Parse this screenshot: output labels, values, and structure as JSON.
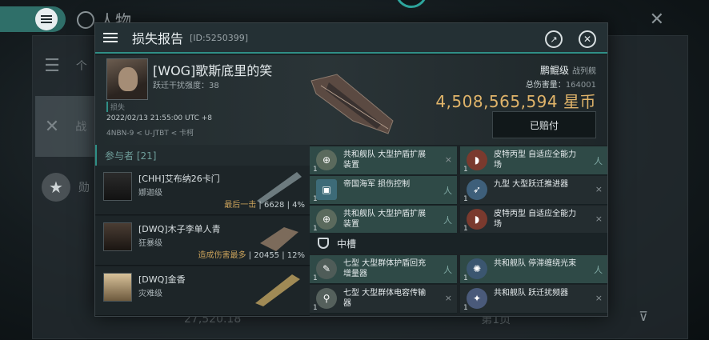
{
  "background": {
    "header_title": "人物",
    "frag_tab1": "个",
    "frag_tab2": "战",
    "frag_tab3": "勋",
    "bottom_value": "27,520.18",
    "bottom_right": "第1页"
  },
  "dialog": {
    "title": "损失报告",
    "report_id": "[ID:5250399]",
    "pilot": {
      "name": "[WOG]歌斯底里的笑",
      "sub": "跃迁干扰强度：38"
    },
    "loss_tag": "损失",
    "time": "2022/02/13 21:55:00 UTC +8",
    "location": "4NBN-9 < U-JTBT < 卡柯",
    "ship": {
      "name": "鹏鲲级",
      "class": "战列舰",
      "damage_label": "总伤害量：",
      "damage_value": "164001",
      "isk": "4,508,565,594 星币"
    },
    "paid_button": "已赔付",
    "participants_header": "参与者 [21]",
    "participants": [
      {
        "name": "[CHH]艾布纳26卡门",
        "ship": "娜迦级",
        "tag": "最后一击",
        "stats": "6628 | 4%"
      },
      {
        "name": "[DWQ]木子李单人青",
        "ship": "狂暴级",
        "tag": "造成伤害最多",
        "stats": "20455 | 12%"
      },
      {
        "name": "[DWQ]金香",
        "ship": "灾难级",
        "tag": "",
        "stats": ""
      }
    ],
    "modules_top": [
      {
        "qty": "1",
        "label": "共和舰队 大型护盾扩展装置",
        "mark": "×"
      },
      {
        "qty": "1",
        "label": "皮特丙型 自适应全能力场",
        "mark": "人"
      },
      {
        "qty": "1",
        "label": "帝国海军 损伤控制",
        "mark": "人"
      },
      {
        "qty": "1",
        "label": "九型 大型跃迁推进器",
        "mark": "×"
      },
      {
        "qty": "1",
        "label": "共和舰队 大型护盾扩展装置",
        "mark": "人"
      },
      {
        "qty": "1",
        "label": "皮特丙型 自适应全能力场",
        "mark": "×"
      }
    ],
    "mid_slot_label": "中槽",
    "modules_mid": [
      {
        "qty": "1",
        "label": "七型 大型群体护盾回充增量器",
        "mark": "人"
      },
      {
        "qty": "1",
        "label": "共和舰队 停滞缠绕光束",
        "mark": "人"
      },
      {
        "qty": "1",
        "label": "七型 大型群体电容传输器",
        "mark": "×"
      },
      {
        "qty": "1",
        "label": "共和舰队 跃迁扰频器",
        "mark": "×"
      }
    ],
    "colors": {
      "accent": "#2f8f86",
      "isk": "#e0b46a",
      "module_hl": "#2f4a47"
    }
  }
}
